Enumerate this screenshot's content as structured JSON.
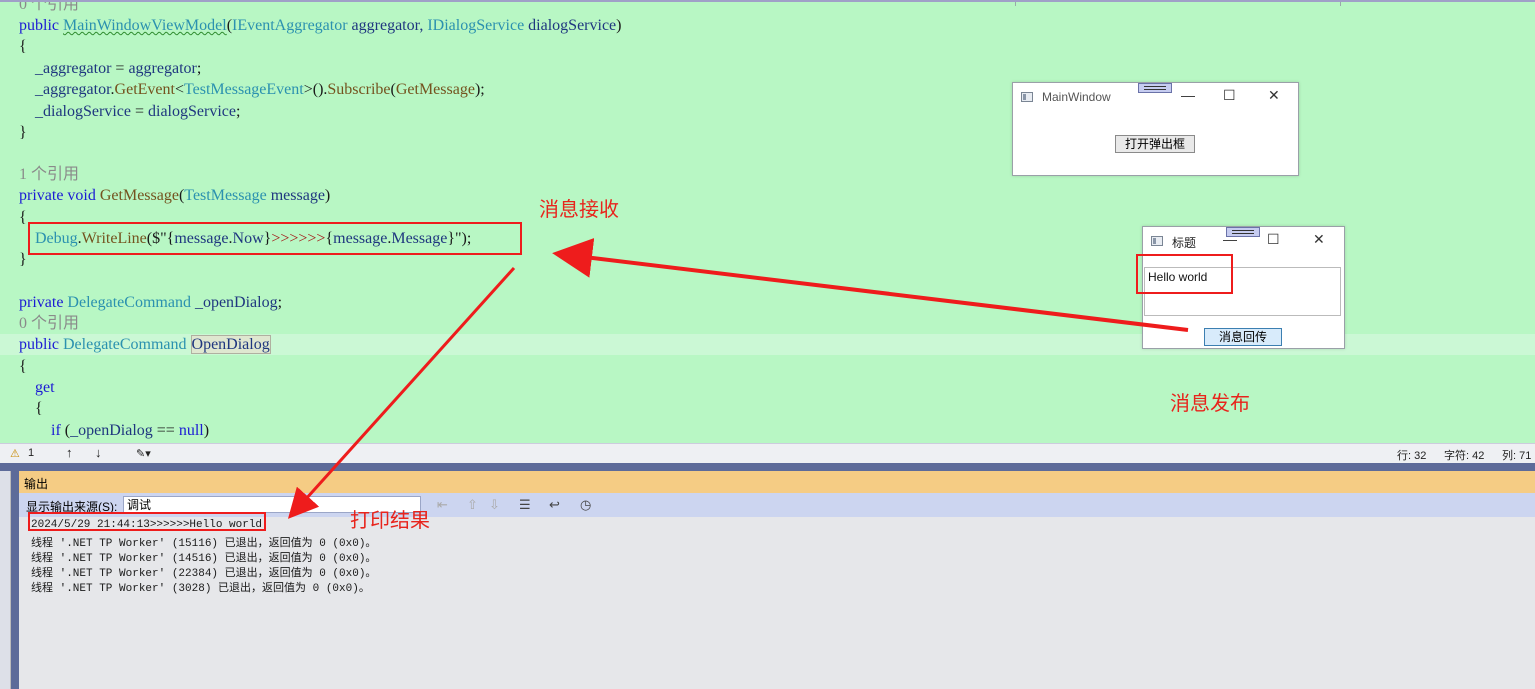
{
  "editor": {
    "lines": [
      {
        "tokens": [
          {
            "c": "refs",
            "s": "0 个引用"
          }
        ]
      },
      {
        "tokens": [
          {
            "c": "kw",
            "s": "public "
          },
          {
            "c": "ty squig",
            "s": "MainWindowViewModel"
          },
          {
            "c": "op",
            "s": "("
          },
          {
            "c": "ty",
            "s": "IEventAggregator"
          },
          {
            "c": "id",
            "s": " aggregator, "
          },
          {
            "c": "ty",
            "s": "IDialogService"
          },
          {
            "c": "id",
            "s": " dialogService"
          },
          {
            "c": "op",
            "s": ")"
          }
        ]
      },
      {
        "tokens": [
          {
            "c": "op",
            "s": "{"
          }
        ]
      },
      {
        "tokens": [
          {
            "c": "id",
            "s": "    _aggregator"
          },
          {
            "c": "op",
            "s": " = "
          },
          {
            "c": "id",
            "s": "aggregator"
          },
          {
            "c": "op",
            "s": ";"
          }
        ]
      },
      {
        "tokens": [
          {
            "c": "id",
            "s": "    _aggregator"
          },
          {
            "c": "op",
            "s": "."
          },
          {
            "c": "mt",
            "s": "GetEvent"
          },
          {
            "c": "op",
            "s": "<"
          },
          {
            "c": "ty",
            "s": "TestMessageEvent"
          },
          {
            "c": "op",
            "s": ">()."
          },
          {
            "c": "mt",
            "s": "Subscribe"
          },
          {
            "c": "op",
            "s": "("
          },
          {
            "c": "mt",
            "s": "GetMessage"
          },
          {
            "c": "op",
            "s": ");"
          }
        ]
      },
      {
        "tokens": [
          {
            "c": "id",
            "s": "    _dialogService"
          },
          {
            "c": "op",
            "s": " = "
          },
          {
            "c": "id",
            "s": "dialogService"
          },
          {
            "c": "op",
            "s": ";"
          }
        ]
      },
      {
        "tokens": [
          {
            "c": "op",
            "s": "}"
          }
        ]
      },
      {
        "tokens": []
      },
      {
        "tokens": [
          {
            "c": "refs",
            "s": "1 个引用"
          }
        ]
      },
      {
        "tokens": [
          {
            "c": "kw",
            "s": "private void "
          },
          {
            "c": "mt",
            "s": "GetMessage"
          },
          {
            "c": "op",
            "s": "("
          },
          {
            "c": "ty",
            "s": "TestMessage"
          },
          {
            "c": "id",
            "s": " message"
          },
          {
            "c": "op",
            "s": ")"
          }
        ]
      },
      {
        "tokens": [
          {
            "c": "op",
            "s": "{"
          }
        ]
      },
      {
        "tokens": [
          {
            "c": "ty",
            "s": "    Debug"
          },
          {
            "c": "op",
            "s": "."
          },
          {
            "c": "mt",
            "s": "WriteLine"
          },
          {
            "c": "op",
            "s": "($\"{"
          },
          {
            "c": "id",
            "s": "message"
          },
          {
            "c": "op",
            "s": "."
          },
          {
            "c": "id",
            "s": "Now"
          },
          {
            "c": "op",
            "s": "}"
          },
          {
            "c": "str",
            "s": ">>>>>>"
          },
          {
            "c": "op",
            "s": "{"
          },
          {
            "c": "id",
            "s": "message"
          },
          {
            "c": "op",
            "s": "."
          },
          {
            "c": "id",
            "s": "Message"
          },
          {
            "c": "op",
            "s": "}\");"
          }
        ]
      },
      {
        "tokens": [
          {
            "c": "op",
            "s": "}"
          }
        ]
      },
      {
        "tokens": []
      },
      {
        "tokens": [
          {
            "c": "kw",
            "s": "private "
          },
          {
            "c": "ty",
            "s": "DelegateCommand"
          },
          {
            "c": "id",
            "s": " _openDialog"
          },
          {
            "c": "op",
            "s": ";"
          }
        ]
      },
      {
        "tokens": [
          {
            "c": "refs",
            "s": "0 个引用"
          }
        ]
      },
      {
        "tokens": [
          {
            "c": "kw",
            "s": "public "
          },
          {
            "c": "ty",
            "s": "DelegateCommand"
          },
          {
            "c": "op",
            "s": " "
          },
          {
            "c": "id hl-box",
            "s": "OpenDialog"
          }
        ]
      },
      {
        "tokens": [
          {
            "c": "op",
            "s": "{"
          }
        ]
      },
      {
        "tokens": [
          {
            "c": "kw",
            "s": "    get"
          }
        ]
      },
      {
        "tokens": [
          {
            "c": "op",
            "s": "    {"
          }
        ]
      },
      {
        "tokens": [
          {
            "c": "kw",
            "s": "        if "
          },
          {
            "c": "op",
            "s": "("
          },
          {
            "c": "id",
            "s": "_openDialog"
          },
          {
            "c": "op",
            "s": " == "
          },
          {
            "c": "kw",
            "s": "null"
          },
          {
            "c": "op",
            "s": ")"
          }
        ]
      }
    ]
  },
  "statusbar": {
    "warnings": "1",
    "line": "行: 32",
    "char": "字符: 42",
    "col": "列: 71"
  },
  "output": {
    "title": "输出",
    "source_label": "显示输出来源(S):",
    "source_value": "调试",
    "lines": [
      "2024/5/29 21:44:13>>>>>>Hello world",
      "线程 '.NET TP Worker' (15116) 已退出，返回值为 0 (0x0)。",
      "线程 '.NET TP Worker' (14516) 已退出，返回值为 0 (0x0)。",
      "线程 '.NET TP Worker' (22384) 已退出，返回值为 0 (0x0)。",
      "线程 '.NET TP Worker' (3028) 已退出，返回值为 0 (0x0)。"
    ]
  },
  "main_window": {
    "title": "MainWindow",
    "button": "打开弹出框"
  },
  "dialog": {
    "title": "标题",
    "textbox_value": "Hello world",
    "button": "消息回传"
  },
  "annotations": {
    "receive": "消息接收",
    "publish": "消息发布",
    "print": "打印结果",
    "color": "#ee1c1c"
  },
  "colors": {
    "editor_bg": "#b8f7c4",
    "output_title_bg": "#f5cc84",
    "output_toolbar_bg": "#ccd5f0"
  }
}
